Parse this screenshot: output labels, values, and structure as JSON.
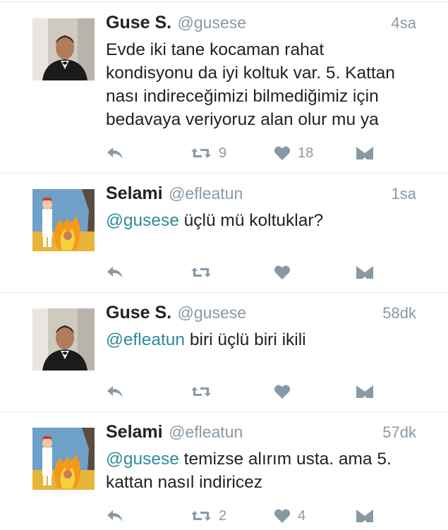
{
  "tweets": [
    {
      "name": "Guse S.",
      "handle": "@gusese",
      "time": "4sa",
      "segments": [
        {
          "text": "Evde iki tane kocaman rahat",
          "mention": false,
          "br": true
        },
        {
          "text": "kondisyonu da iyi koltuk var. 5. Kattan",
          "mention": false,
          "br": true
        },
        {
          "text": "nası indireceğimizi bilmediğimiz için",
          "mention": false,
          "br": true
        },
        {
          "text": "bedavaya veriyoruz alan olur mu ya",
          "mention": false,
          "br": false
        }
      ],
      "retweets": "9",
      "likes": "18",
      "avatar": "man-in-tuxedo"
    },
    {
      "name": "Selami",
      "handle": "@efleatun",
      "time": "1sa",
      "segments": [
        {
          "text": "@gusese",
          "mention": true,
          "br": false
        },
        {
          "text": " üçlü mü koltuklar?",
          "mention": false,
          "br": false
        }
      ],
      "retweets": "",
      "likes": "",
      "avatar": "cartoon-fire"
    },
    {
      "name": "Guse S.",
      "handle": "@gusese",
      "time": "58dk",
      "segments": [
        {
          "text": "@efleatun",
          "mention": true,
          "br": false
        },
        {
          "text": " biri üçlü biri ikili",
          "mention": false,
          "br": false
        }
      ],
      "retweets": "",
      "likes": "",
      "avatar": "man-in-tuxedo"
    },
    {
      "name": "Selami",
      "handle": "@efleatun",
      "time": "57dk",
      "segments": [
        {
          "text": "@gusese",
          "mention": true,
          "br": false
        },
        {
          "text": " temizse alırım usta. ama 5.",
          "mention": false,
          "br": true
        },
        {
          "text": "kattan nasıl indiricez",
          "mention": false,
          "br": false
        }
      ],
      "retweets": "2",
      "likes": "4",
      "avatar": "cartoon-fire"
    }
  ],
  "icons": {
    "reply": "reply-icon",
    "retweet": "retweet-icon",
    "like": "heart-icon",
    "dm": "direct-message-icon"
  },
  "colors": {
    "mention": "#2e8a9a",
    "meta": "#8899a6",
    "divider": "#e3e6e8"
  }
}
